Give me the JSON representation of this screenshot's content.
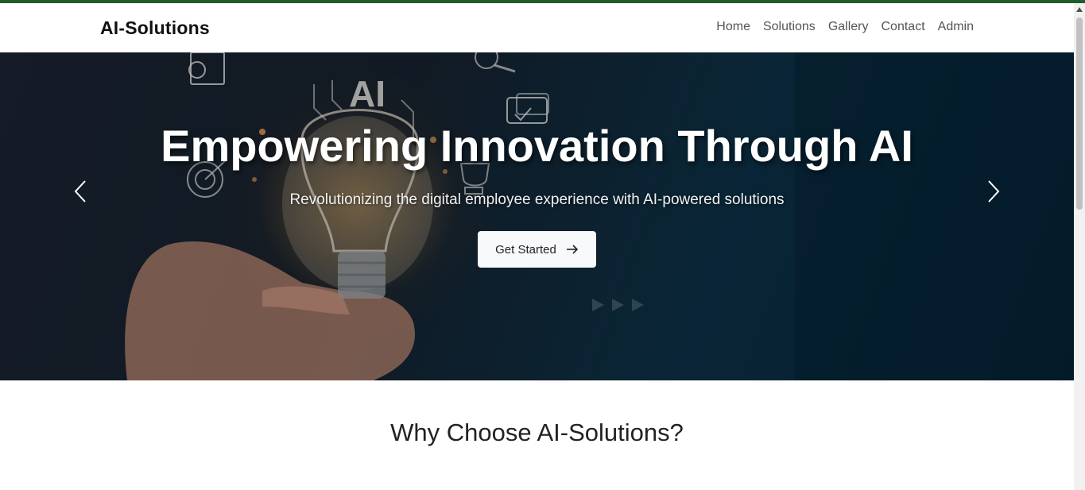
{
  "brand": {
    "name": "AI-Solutions"
  },
  "nav": {
    "items": [
      {
        "label": "Home"
      },
      {
        "label": "Solutions"
      },
      {
        "label": "Gallery"
      },
      {
        "label": "Contact"
      },
      {
        "label": "Admin"
      }
    ]
  },
  "hero": {
    "title": "Empowering Innovation Through AI",
    "subtitle": "Revolutionizing the digital employee experience with AI-powered solutions",
    "cta_label": "Get Started",
    "cta_icon": "arrow-right-icon",
    "image_text": "AI"
  },
  "section": {
    "title": "Why Choose AI-Solutions?"
  },
  "colors": {
    "topbar": "#1f5e2c",
    "button_bg": "#f8f9fa",
    "title_text": "#ffffff"
  }
}
